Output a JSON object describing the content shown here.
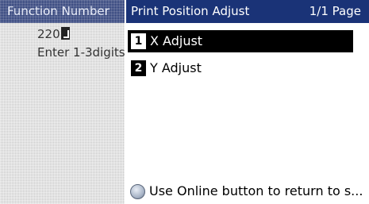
{
  "background": {
    "header": "Function Number",
    "value": "220",
    "hint": "Enter 1-3digits"
  },
  "dialog": {
    "title": "Print Position Adjust",
    "page": "1/1 Page",
    "items": [
      {
        "number": "1",
        "label": "X Adjust",
        "selected": true
      },
      {
        "number": "2",
        "label": "Y Adjust",
        "selected": false
      }
    ],
    "footer": "Use Online button to return to s..."
  },
  "colors": {
    "title_bar": "#1a3377",
    "selection": "#000000"
  },
  "icons": {
    "cursor": "enter-cursor-icon",
    "online": "online-button-icon"
  }
}
